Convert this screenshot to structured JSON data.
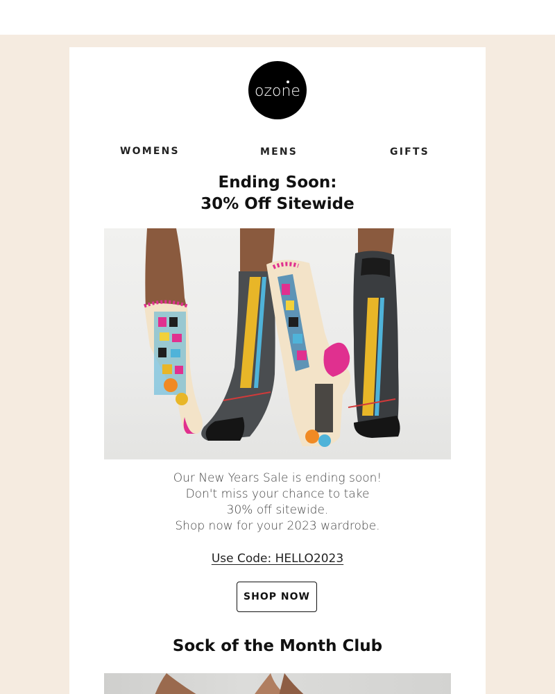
{
  "brand": {
    "logo_text": "ozone",
    "logo_icon": "ozone-logo"
  },
  "nav": {
    "items": [
      {
        "label": "WOMENS"
      },
      {
        "label": "MENS"
      },
      {
        "label": "GIFTS"
      }
    ]
  },
  "hero": {
    "headline_line1": "Ending Soon:",
    "headline_line2": "30% Off Sitewide",
    "image_subject": "two legs in patterned socks"
  },
  "body": {
    "lines": [
      "Our New Years Sale is ending soon!",
      "Don't miss your chance to take",
      "30% off sitewide.",
      "Shop now for your 2023 wardrobe."
    ],
    "promo_code": "Use Code: HELLO2023",
    "cta_label": "SHOP NOW"
  },
  "club": {
    "title": "Sock of the Month Club"
  },
  "colors": {
    "backdrop": "#f5ebe0",
    "card": "#ffffff",
    "text": "#111111",
    "accent_pink": "#e0308f",
    "accent_yellow": "#e8b628"
  }
}
